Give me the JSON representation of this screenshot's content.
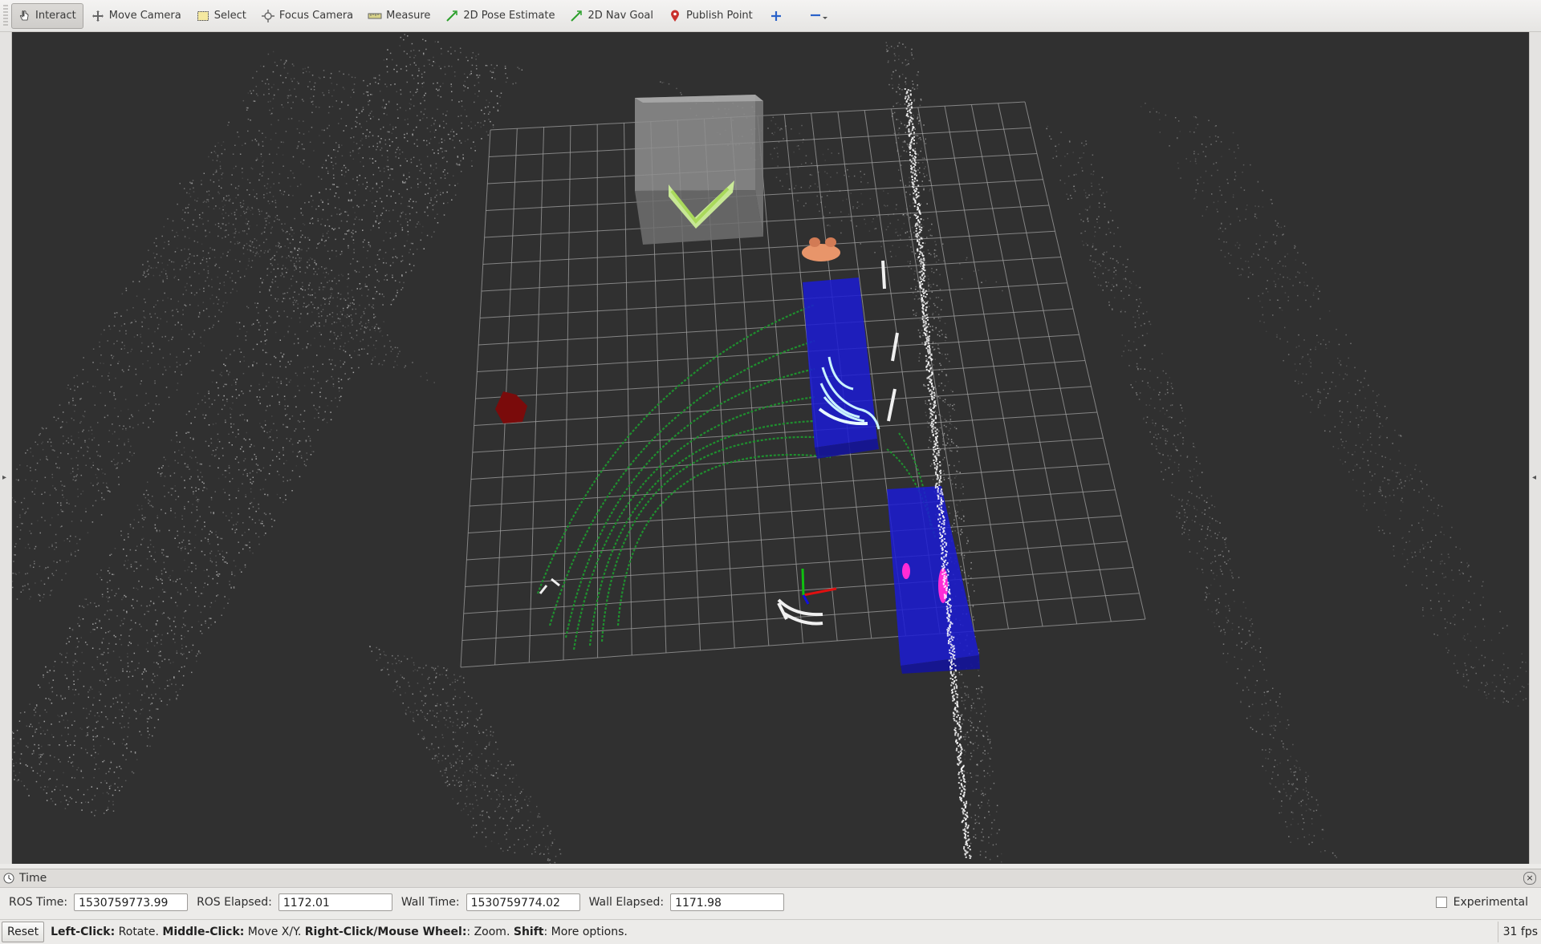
{
  "toolbar": {
    "tools": [
      {
        "label": "Interact",
        "icon": "hand-pointer-icon",
        "active": true
      },
      {
        "label": "Move Camera",
        "icon": "move-camera-icon"
      },
      {
        "label": "Select",
        "icon": "select-rect-icon"
      },
      {
        "label": "Focus Camera",
        "icon": "focus-camera-icon"
      },
      {
        "label": "Measure",
        "icon": "ruler-icon"
      },
      {
        "label": "2D Pose Estimate",
        "icon": "green-arrow-icon"
      },
      {
        "label": "2D Nav Goal",
        "icon": "green-arrow-icon"
      },
      {
        "label": "Publish Point",
        "icon": "map-pin-icon"
      }
    ],
    "add_tool_icon": "plus-icon",
    "remove_tool_icon": "minus-dropdown-icon"
  },
  "colors": {
    "viewport_bg": "#303030",
    "grid": "#a0a0a0",
    "green_scan": "#1f8f2f",
    "blue_box": "#1e1ecf",
    "magenta": "#ff2bd6",
    "light_green": "#c6f07a",
    "axis_red": "#e01010",
    "axis_green": "#10c010",
    "axis_blue": "#1010e0"
  },
  "time_panel": {
    "title": "Time",
    "ros_time_label": "ROS Time:",
    "ros_time_value": "1530759773.99",
    "ros_elapsed_label": "ROS Elapsed:",
    "ros_elapsed_value": "1172.01",
    "wall_time_label": "Wall Time:",
    "wall_time_value": "1530759774.02",
    "wall_elapsed_label": "Wall Elapsed:",
    "wall_elapsed_value": "1171.98",
    "experimental_label": "Experimental",
    "experimental_checked": false
  },
  "status": {
    "reset_label": "Reset",
    "hint_left_click": "Left-Click:",
    "hint_rotate": " Rotate. ",
    "hint_middle_click": "Middle-Click:",
    "hint_move": " Move X/Y. ",
    "hint_right_click": "Right-Click/Mouse Wheel:",
    "hint_zoom": ": Zoom. ",
    "hint_shift": "Shift",
    "hint_more": ": More options.",
    "fps": "31 fps"
  }
}
